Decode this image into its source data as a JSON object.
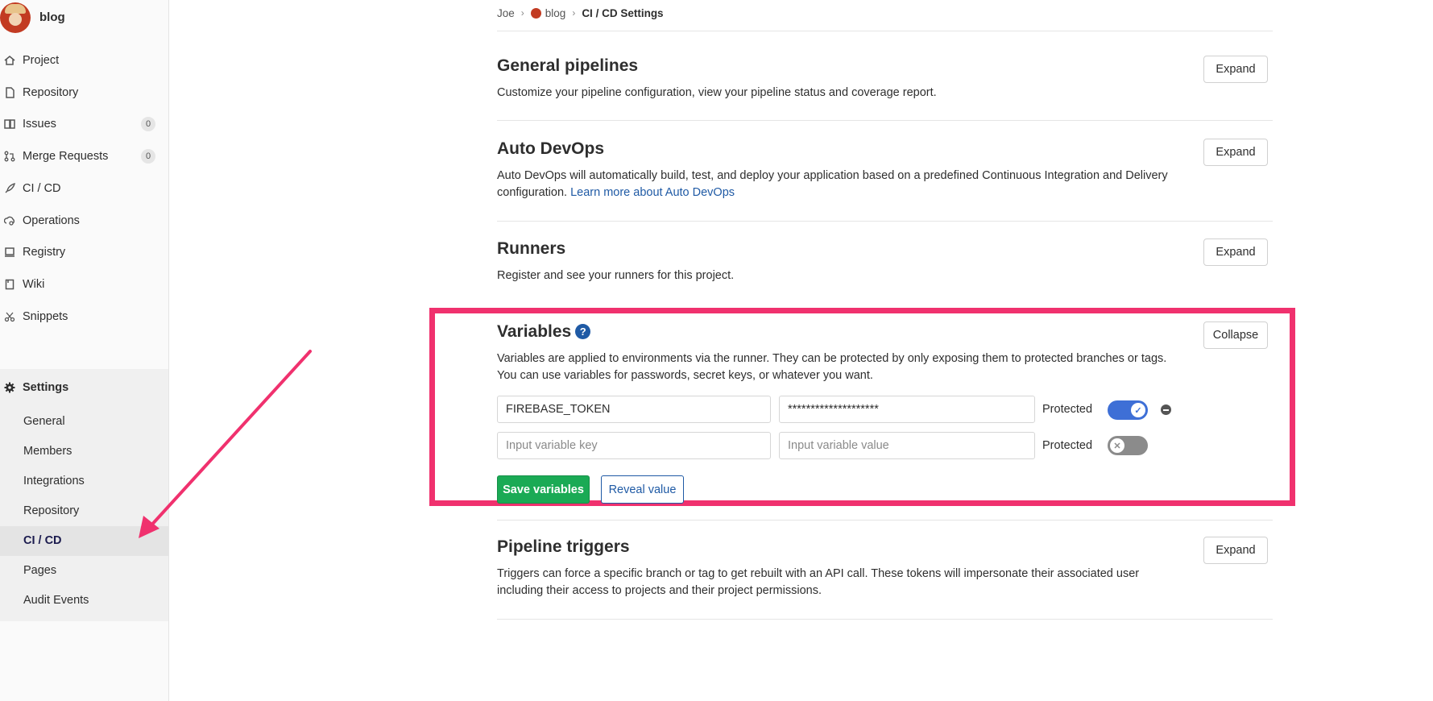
{
  "project": {
    "name": "blog"
  },
  "nav": {
    "items": [
      {
        "label": "Project",
        "icon": "house-icon"
      },
      {
        "label": "Repository",
        "icon": "doc-icon"
      },
      {
        "label": "Issues",
        "icon": "issues-icon",
        "count": "0"
      },
      {
        "label": "Merge Requests",
        "icon": "merge-icon",
        "count": "0"
      },
      {
        "label": "CI / CD",
        "icon": "rocket-icon"
      },
      {
        "label": "Operations",
        "icon": "cloud-gear-icon"
      },
      {
        "label": "Registry",
        "icon": "registry-icon"
      },
      {
        "label": "Wiki",
        "icon": "book-icon"
      },
      {
        "label": "Snippets",
        "icon": "scissors-icon"
      }
    ],
    "settings": {
      "label": "Settings",
      "items": [
        "General",
        "Members",
        "Integrations",
        "Repository",
        "CI / CD",
        "Pages",
        "Audit Events"
      ]
    }
  },
  "breadcrumb": {
    "user": "Joe",
    "project": "blog",
    "current": "CI / CD Settings"
  },
  "sections": {
    "general": {
      "title": "General pipelines",
      "desc": "Customize your pipeline configuration, view your pipeline status and coverage report.",
      "button": "Expand"
    },
    "autodevops": {
      "title": "Auto DevOps",
      "desc": "Auto DevOps will automatically build, test, and deploy your application based on a predefined Continuous Integration and Delivery configuration.",
      "link": "Learn more about Auto DevOps",
      "button": "Expand"
    },
    "runners": {
      "title": "Runners",
      "desc": "Register and see your runners for this project.",
      "button": "Expand"
    },
    "variables": {
      "title": "Variables",
      "desc1": "Variables are applied to environments via the runner. They can be protected by only exposing them to protected branches or tags.",
      "desc2": "You can use variables for passwords, secret keys, or whatever you want.",
      "button": "Collapse",
      "row1": {
        "key": "FIREBASE_TOKEN",
        "value": "********************",
        "protected_label": "Protected"
      },
      "row2": {
        "key_placeholder": "Input variable key",
        "value_placeholder": "Input variable value",
        "protected_label": "Protected"
      },
      "save": "Save variables",
      "reveal": "Reveal value"
    },
    "triggers": {
      "title": "Pipeline triggers",
      "desc": "Triggers can force a specific branch or tag to get rebuilt with an API call. These tokens will impersonate their associated user including their access to projects and their project permissions.",
      "button": "Expand"
    }
  },
  "colors": {
    "highlight": "#f0316e",
    "link": "#1f5aa5",
    "save": "#1aaa55",
    "toggle_on": "#3e6fd6"
  }
}
